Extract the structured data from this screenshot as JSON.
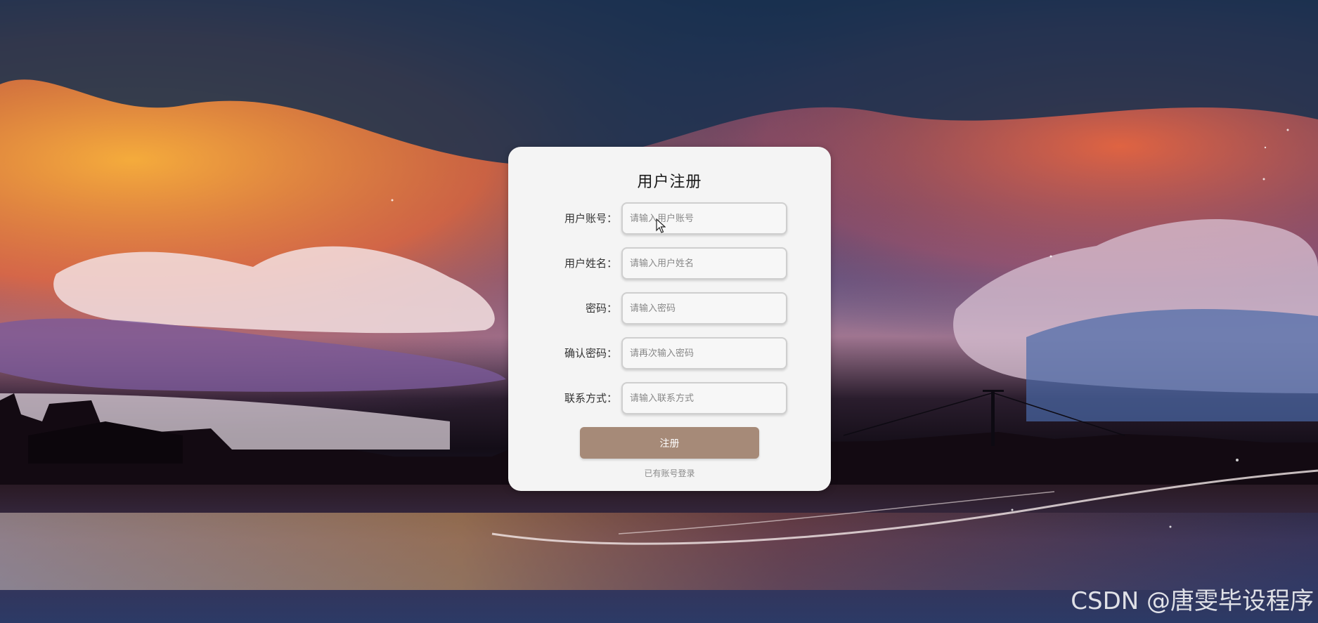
{
  "form": {
    "title": "用户注册",
    "fields": [
      {
        "label": "用户账号：",
        "placeholder": "请输入用户账号",
        "value": ""
      },
      {
        "label": "用户姓名：",
        "placeholder": "请输入用户姓名",
        "value": ""
      },
      {
        "label": "密码：",
        "placeholder": "请输入密码",
        "value": ""
      },
      {
        "label": "确认密码：",
        "placeholder": "请再次输入密码",
        "value": ""
      },
      {
        "label": "联系方式：",
        "placeholder": "请输入联系方式",
        "value": ""
      }
    ],
    "submit_label": "注册",
    "login_link": "已有账号登录"
  },
  "watermark": "CSDN @唐雯毕设程序",
  "colors": {
    "card_bg": "#f4f4f4",
    "button_bg": "#a68a78",
    "button_text": "#ffffff"
  }
}
